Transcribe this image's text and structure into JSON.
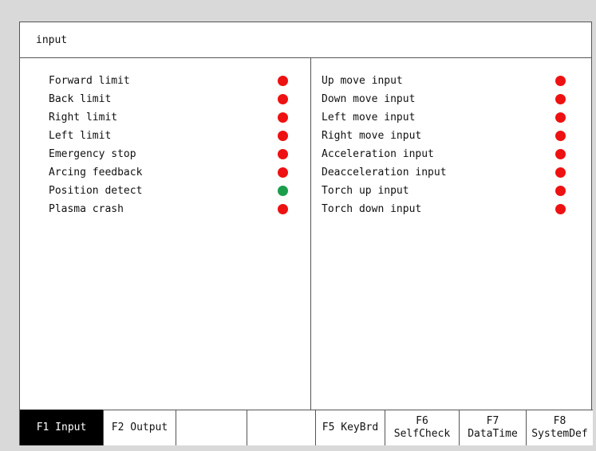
{
  "header": {
    "title": "input"
  },
  "colors": {
    "on": "#1a9e4a",
    "off": "#ee1111",
    "active_key_bg": "#000000"
  },
  "left_inputs": [
    {
      "label": "Forward limit",
      "state": "off"
    },
    {
      "label": "Back limit",
      "state": "off"
    },
    {
      "label": "Right limit",
      "state": "off"
    },
    {
      "label": "Left limit",
      "state": "off"
    },
    {
      "label": "Emergency stop",
      "state": "off"
    },
    {
      "label": "Arcing feedback",
      "state": "off"
    },
    {
      "label": "Position detect",
      "state": "on"
    },
    {
      "label": "Plasma crash",
      "state": "off"
    }
  ],
  "right_inputs": [
    {
      "label": "Up move input",
      "state": "off"
    },
    {
      "label": "Down move input",
      "state": "off"
    },
    {
      "label": "Left move input",
      "state": "off"
    },
    {
      "label": "Right move input",
      "state": "off"
    },
    {
      "label": "Acceleration input",
      "state": "off"
    },
    {
      "label": "Deacceleration input",
      "state": "off"
    },
    {
      "label": "Torch up input",
      "state": "off"
    },
    {
      "label": "Torch down input",
      "state": "off"
    }
  ],
  "function_keys": {
    "f1": {
      "label": "F1 Input",
      "active": true
    },
    "f2": {
      "label": "F2 Output",
      "active": false
    },
    "f3": {
      "label": "",
      "active": false
    },
    "f4": {
      "label": "",
      "active": false
    },
    "f5": {
      "label": "F5 KeyBrd",
      "active": false
    },
    "f6": {
      "label": "F6 SelfCheck",
      "active": false
    },
    "f7": {
      "line1": "F7",
      "line2": "DataTime",
      "active": false
    },
    "f8": {
      "line1": "F8",
      "line2": "SystemDef",
      "active": false
    }
  }
}
